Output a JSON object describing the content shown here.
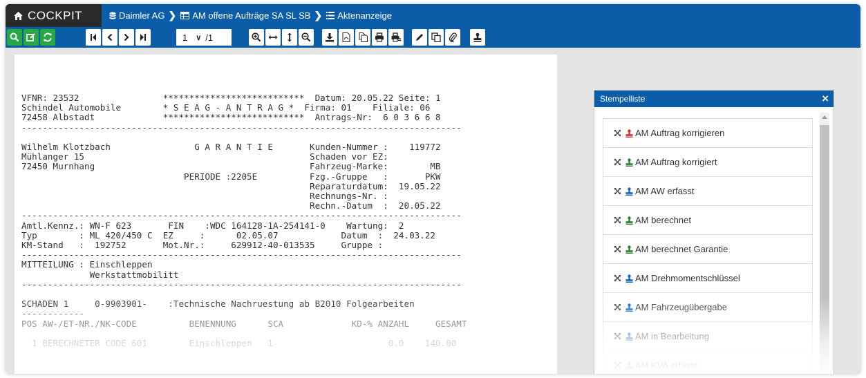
{
  "app": {
    "title": "COCKPIT"
  },
  "breadcrumb": [
    {
      "label": "Daimler AG",
      "icon": "database-icon"
    },
    {
      "label": "AM offene Aufträge SA SL SB",
      "icon": "table-icon"
    },
    {
      "label": "Aktenanzeige",
      "icon": "list-icon"
    }
  ],
  "toolbar": {
    "page_current": "1",
    "page_total": "/1",
    "colors": {
      "bar": "#0a5da6",
      "green": "#27a745"
    }
  },
  "document": {
    "lines": [
      "VFNR: 23532                ***************************  Datum: 20.05.22 Seite: 1",
      "Schindel Automobile        * S E A G - A N T R A G *  Firma: 01    Filiale: 06",
      "72458 Albstadt             ***************************  Antrags-Nr:  6 0 3 6 6 8",
      "------------------------------------------------------------------------------------",
      "",
      "Wilhelm Klotzbach                G A R A N T I E       Kunden-Nummer :    119772",
      "Mühlanger 15                                           Schaden vor EZ:",
      "72450 Murnhang                                         Fahrzeug-Marke:        MB",
      "                               PERIODE :2205E          Fzg.-Gruppe   :       PKW",
      "                                                       Reparaturdatum:  19.05.22",
      "                                                       Rechnungs-Nr. :",
      "                                                       Rechn.-Datum  :  20.05.22",
      "------------------------------------------------------------------------------------",
      "Amtl.Kennz.: WN-F 623       FIN    :WDC 164128-1A-254141-0    Wartung:  2",
      "Typ        : ML 420/450 C  EZ     :      02.05.07            Datum  :  24.03.22",
      "KM-Stand   :  192752       Mot.Nr.:     629912-40-013535     Gruppe :",
      "------------------------------------------------------------------------------------",
      "MITTEILUNG : Einschleppen",
      "             Werkstattmobilitt",
      "------------------------------------------------------------------------------------",
      "",
      "SCHADEN 1     0-9903901-    :Technische Nachruestung ab B2010 Folgearbeiten",
      "------------",
      "POS AW-/ET-NR./NK-CODE          BENENNUNG      SCA             KD-% ANZAHL     GESAMT",
      "",
      "  1 BERECHNETER CODE 601        Einschleppen   1                      0.0    140.00"
    ]
  },
  "stamp_panel": {
    "title": "Stempelliste",
    "close_label": "×",
    "items": [
      {
        "label": "AM Auftrag korrigieren",
        "stamp_color": "#d32f2f"
      },
      {
        "label": "AM Auftrag korrigiert",
        "stamp_color": "#2e7d32"
      },
      {
        "label": "AM AW erfasst",
        "stamp_color": "#1565c0"
      },
      {
        "label": "AM berechnet",
        "stamp_color": "#2e7d32"
      },
      {
        "label": "AM berechnet Garantie",
        "stamp_color": "#2e7d32"
      },
      {
        "label": "AM Drehmomentschlüssel",
        "stamp_color": "#1565c0"
      },
      {
        "label": "AM Fahrzeugübergabe",
        "stamp_color": "#1565c0"
      },
      {
        "label": "AM in Bearbeitung",
        "stamp_color": "#1565c0"
      },
      {
        "label": "AM KVA erfasst",
        "stamp_color": "#1565c0"
      }
    ]
  }
}
